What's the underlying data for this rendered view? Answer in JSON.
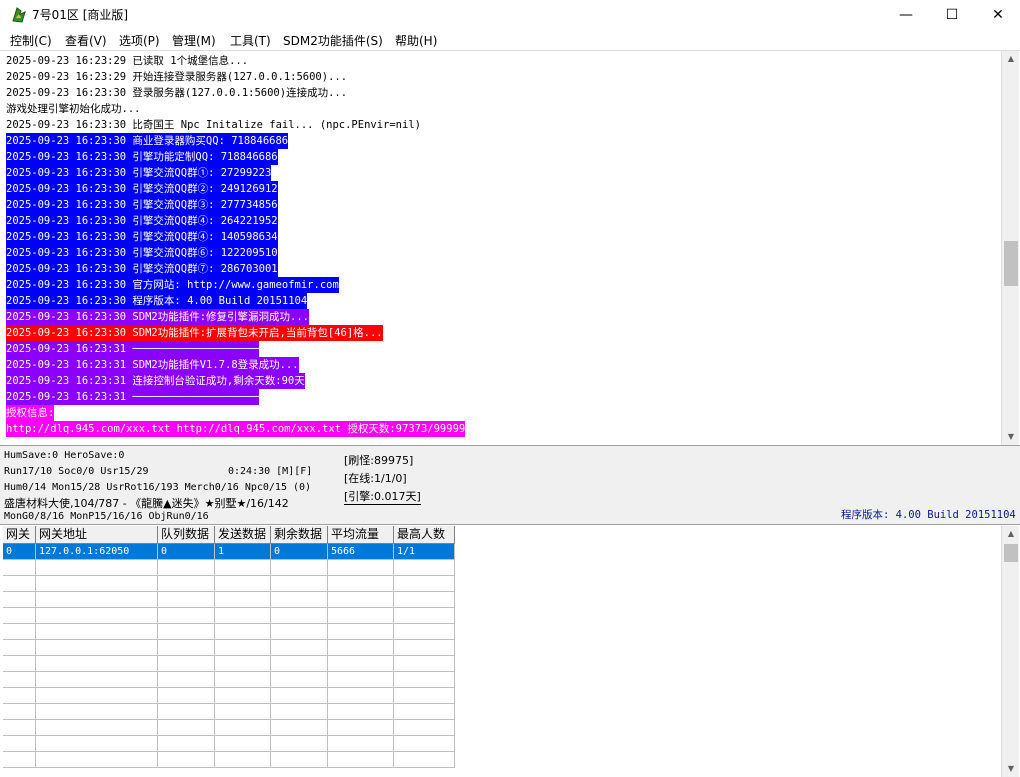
{
  "window": {
    "title": "7号01区 [商业版]",
    "min_glyph": "—",
    "max_glyph": "☐",
    "close_glyph": "✕"
  },
  "menu": [
    {
      "label": "控制(C)"
    },
    {
      "label": "查看(V)"
    },
    {
      "label": "选项(P)"
    },
    {
      "label": "管理(M)"
    },
    {
      "label": "工具(T)"
    },
    {
      "label": "SDM2功能插件(S)"
    },
    {
      "label": "帮助(H)"
    }
  ],
  "log": [
    {
      "text": "2025-09-23 16:23:29 已读取 1个城堡信息...",
      "bg": "",
      "color": "#000000"
    },
    {
      "text": "2025-09-23 16:23:29 开始连接登录服务器(127.0.0.1:5600)...",
      "bg": "",
      "color": "#000000"
    },
    {
      "text": "2025-09-23 16:23:30 登录服务器(127.0.0.1:5600)连接成功...",
      "bg": "",
      "color": "#000000"
    },
    {
      "text": "游戏处理引擎初始化成功...",
      "bg": "",
      "color": "#000000"
    },
    {
      "text": "2025-09-23 16:23:30 比奇国王 Npc Initalize fail... (npc.PEnvir=nil)",
      "bg": "",
      "color": "#000000"
    },
    {
      "text": "2025-09-23 16:23:30 商业登录器购买QQ: 718846686",
      "bg": "#0000ff",
      "color": "#ffffff"
    },
    {
      "text": "2025-09-23 16:23:30 引擎功能定制QQ: 718846686",
      "bg": "#0000ff",
      "color": "#ffffff"
    },
    {
      "text": "2025-09-23 16:23:30 引擎交流QQ群①: 27299223",
      "bg": "#0000ff",
      "color": "#ffffff"
    },
    {
      "text": "2025-09-23 16:23:30 引擎交流QQ群②: 249126912",
      "bg": "#0000ff",
      "color": "#ffffff"
    },
    {
      "text": "2025-09-23 16:23:30 引擎交流QQ群③: 277734856",
      "bg": "#0000ff",
      "color": "#ffffff"
    },
    {
      "text": "2025-09-23 16:23:30 引擎交流QQ群④: 264221952",
      "bg": "#0000ff",
      "color": "#ffffff"
    },
    {
      "text": "2025-09-23 16:23:30 引擎交流QQ群④: 140598634",
      "bg": "#0000ff",
      "color": "#ffffff"
    },
    {
      "text": "2025-09-23 16:23:30 引擎交流QQ群⑥: 122209510",
      "bg": "#0000ff",
      "color": "#ffffff"
    },
    {
      "text": "2025-09-23 16:23:30 引擎交流QQ群⑦: 286703001",
      "bg": "#0000ff",
      "color": "#ffffff"
    },
    {
      "text": "2025-09-23 16:23:30 官方网站: http://www.gameofmir.com",
      "bg": "#0000ff",
      "color": "#ffffff"
    },
    {
      "text": "2025-09-23 16:23:30 程序版本: 4.00 Build 20151104",
      "bg": "#0000ff",
      "color": "#ffffff"
    },
    {
      "text": "2025-09-23 16:23:30 SDM2功能插件:修复引擎漏洞成功...",
      "bg": "#8b00ff",
      "color": "#ffffff"
    },
    {
      "text": "2025-09-23 16:23:30 SDM2功能插件:扩展背包未开启,当前背包[46]格...",
      "bg": "#ff0000",
      "color": "#ffffff"
    },
    {
      "text": "2025-09-23 16:23:31 ────────────────────",
      "bg": "#8b00ff",
      "color": "#ffffff"
    },
    {
      "text": "2025-09-23 16:23:31 SDM2功能插件V1.7.8登录成功...",
      "bg": "#8b00ff",
      "color": "#ffffff"
    },
    {
      "text": "2025-09-23 16:23:31 连接控制台验证成功,剩余天数:90天",
      "bg": "#8b00ff",
      "color": "#ffffff"
    },
    {
      "text": "2025-09-23 16:23:31 ────────────────────",
      "bg": "#8b00ff",
      "color": "#ffffff"
    },
    {
      "text": "授权信息:",
      "bg": "#ff00ff",
      "color": "#ffffff"
    },
    {
      "text": "http://dlq.945.com/xxx.txt http://dlq.945.com/xxx.txt 授权天数:97373/99999",
      "bg": "#ff00ff",
      "color": "#ffffff"
    }
  ],
  "status": {
    "line1": "HumSave:0 HeroSave:0",
    "line2a": "Run17/10 Soc0/0 Usr15/29",
    "line2b": "0:24:30 [M][F]",
    "line3": "Hum0/14 Mon15/28 UsrRot16/193 Merch0/16 Npc0/15 (0)",
    "line4": "盛唐材料大使,104/787 - 《龍騰▲迷失》★别墅★/16/142",
    "line5": "MonG0/8/16 MonP15/16/16 ObjRun0/16",
    "refresh": "[刷怪:89975]",
    "online": "[在线:1/1/0]",
    "engine": "[引擎:0.017天]",
    "version": "程序版本: 4.00 Build 20151104"
  },
  "grid": {
    "headers": [
      "网关",
      "网关地址",
      "队列数据",
      "发送数据",
      "剩余数据",
      "平均流量",
      "最高人数"
    ],
    "rows": [
      [
        "0",
        "127.0.0.1:62050",
        "0",
        "1",
        "0",
        "5666",
        "1/1"
      ]
    ]
  },
  "scroll_up": "▲",
  "scroll_down": "▼"
}
